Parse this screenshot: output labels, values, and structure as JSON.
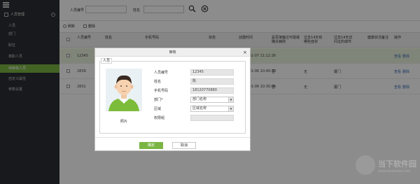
{
  "sidebar": {
    "group_label": "人员管理",
    "items": [
      {
        "label": "人员"
      },
      {
        "label": "部门"
      },
      {
        "label": "职位"
      },
      {
        "label": "离职人员"
      },
      {
        "label": "待审核人员"
      },
      {
        "label": "自定义属性"
      },
      {
        "label": "参数设置"
      }
    ]
  },
  "search": {
    "person_no_label": "人员编号",
    "person_no_value": "",
    "name_label": "姓名",
    "name_value": ""
  },
  "toolbar": {
    "refresh_label": "刷新",
    "delete_label": "删除"
  },
  "table": {
    "headers": {
      "person_no": "人员编号",
      "name": "姓名",
      "phone": "手机号码",
      "status": "状态",
      "created": "创建时间",
      "contact": "是否接触过可疑或确诊病例",
      "symptom": "过去14天有哪些症状",
      "visited": "过去14天访问过的城市",
      "health": "健康状况备注",
      "ops": "操作"
    },
    "rows": [
      {
        "person_no": "12345",
        "created": "2020-01-07 11:12:26",
        "contact": "",
        "symptom": "",
        "visited": "",
        "op1": "查看",
        "op2": "删除"
      },
      {
        "person_no": "2839",
        "created": "2020-01-06 10:40:39",
        "contact": "否",
        "symptom": "无",
        "visited": "厦门",
        "op1": "查看",
        "op2": "删除"
      },
      {
        "person_no": "2831",
        "created": "2020-01-06 10:30:06",
        "contact": "否",
        "symptom": "无",
        "visited": "厦门",
        "op1": "查看",
        "op2": "删除"
      }
    ]
  },
  "dialog": {
    "title": "审核",
    "legend": "人员",
    "photo_caption": "照片",
    "fields": [
      {
        "label": "人员编号",
        "value": "12345"
      },
      {
        "label": "姓名",
        "value": "陈"
      },
      {
        "label": "手机号码",
        "value": "18120770880"
      },
      {
        "label": "部门*",
        "value": "部门名称"
      },
      {
        "label": "区域",
        "value": "区域名称"
      },
      {
        "label": "权限组",
        "value": ""
      }
    ],
    "ok_label": "确定",
    "cancel_label": "取消"
  },
  "watermark": {
    "text": "当下软件园",
    "url": "www.downxia.com"
  },
  "colors": {
    "accent": "#7ab544",
    "sidebar_bg": "#2a2f33"
  }
}
